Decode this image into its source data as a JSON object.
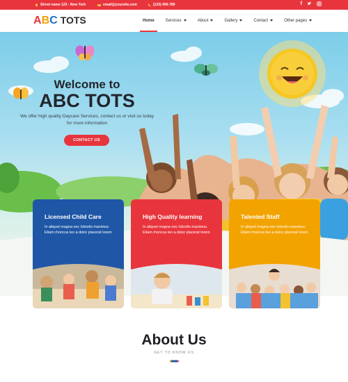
{
  "topbar": {
    "address": "Street name 123 - New York",
    "email": "email@yoursite.com",
    "phone": "(123) 456-789",
    "social": [
      "f-icon",
      "twitter-icon",
      "instagram-icon"
    ]
  },
  "brand": {
    "letters": [
      "A",
      "B",
      "C"
    ],
    "name": "TOTS"
  },
  "nav": {
    "items": [
      {
        "label": "Home",
        "dropdown": false
      },
      {
        "label": "Services",
        "dropdown": true
      },
      {
        "label": "About",
        "dropdown": true
      },
      {
        "label": "Gallery",
        "dropdown": true
      },
      {
        "label": "Contact",
        "dropdown": true
      },
      {
        "label": "Other pages",
        "dropdown": true
      }
    ]
  },
  "hero": {
    "welcome": "Welcome to",
    "title": "ABC TOTS",
    "subtitle": "We offer high quality Daycare Services, contact us or visit us today for more information",
    "cta": "CONTACT US"
  },
  "cards": [
    {
      "title": "Licensed Child Care",
      "text": "In aliquet magna nec lobortis maximus. Etiam rhoncus leo a dolor placerat lorem",
      "color": "#1f57a6"
    },
    {
      "title": "High Quality learning",
      "text": "In aliquet magna nec lobortis maximus. Etiam rhoncus leo a dolor placerat lorem",
      "color": "#e8353d"
    },
    {
      "title": "Talented Staff",
      "text": "In aliquet magna nec lobortis maximus. Etiam rhoncus leo a dolor placerat lorem",
      "color": "#f2a300"
    }
  ],
  "about": {
    "title": "About Us",
    "subtitle": "GET TO KNOW US"
  },
  "colors": {
    "accent": "#e8353d",
    "blue": "#1f57a6",
    "yellow": "#f2a300"
  }
}
